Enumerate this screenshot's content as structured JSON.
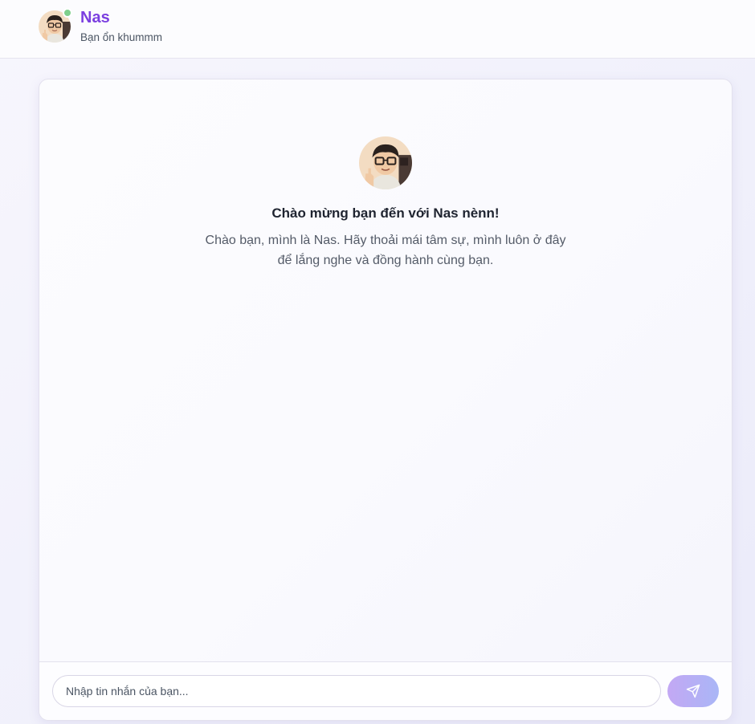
{
  "header": {
    "name": "Nas",
    "status": "Bạn ổn khummm",
    "online_color": "#7fcf8c",
    "name_color": "#7b3fe0"
  },
  "welcome": {
    "title": "Chào mừng bạn đến với Nas nènn!",
    "message": "Chào bạn, mình là Nas. Hãy thoải mái tâm sự, mình luôn ở đây để lắng nghe và đồng hành cùng bạn."
  },
  "composer": {
    "placeholder": "Nhập tin nhắn của bạn...",
    "value": "",
    "send_icon": "send-icon"
  },
  "icons": {
    "avatar": "avatar-illustration",
    "online": "online-status-dot"
  }
}
